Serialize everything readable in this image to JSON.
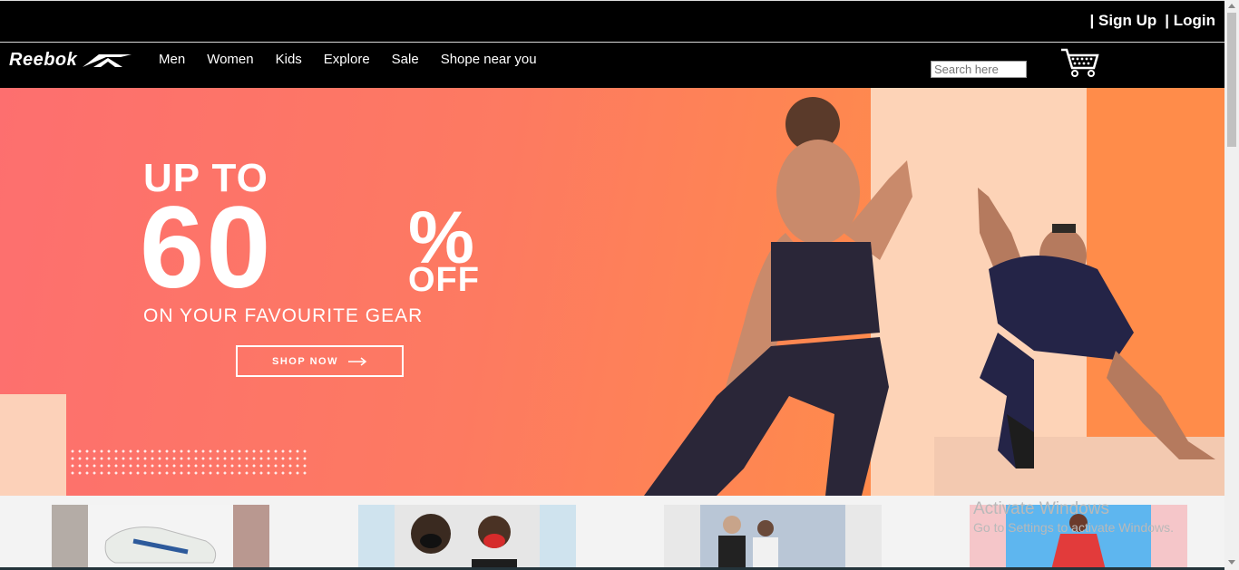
{
  "header": {
    "sign_up": "| Sign Up",
    "login": "| Login",
    "brand": "Reebok",
    "nav": [
      {
        "label": "Men"
      },
      {
        "label": "Women"
      },
      {
        "label": "Kids"
      },
      {
        "label": "Explore"
      },
      {
        "label": "Sale"
      },
      {
        "label": "Shope near you"
      }
    ],
    "search_placeholder": "Search here"
  },
  "hero": {
    "line1": "UP TO",
    "line2": "60",
    "percent": "%",
    "off": "OFF",
    "line3": "ON YOUR FAVOURITE GEAR",
    "cta": "SHOP NOW"
  },
  "overlay": {
    "activate_title": "Activate Windows",
    "activate_sub": "Go to Settings to activate Windows."
  },
  "colors": {
    "hero_start": "#fd6f6f",
    "hero_end": "#ff8c4a",
    "nav_bg": "#000000"
  }
}
